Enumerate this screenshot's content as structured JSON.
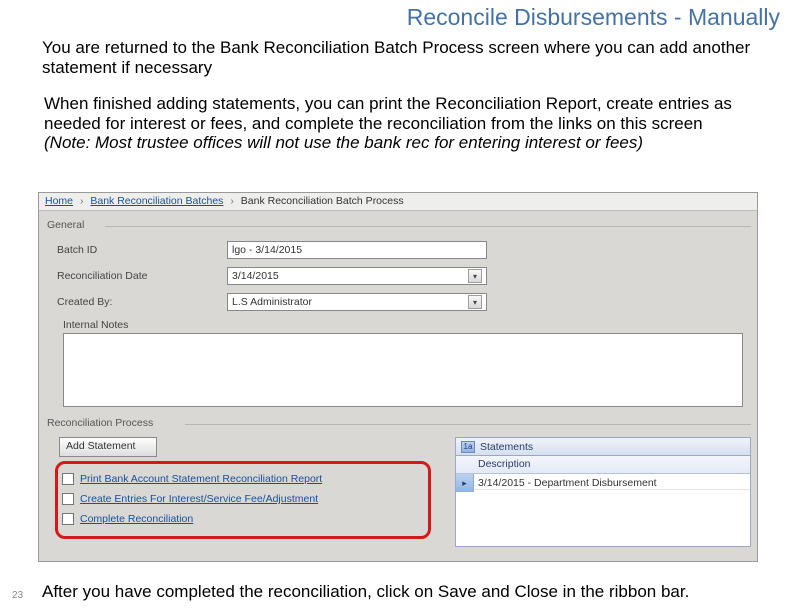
{
  "slide": {
    "title": "Reconcile Disbursements - Manually",
    "para1": "You are returned to the Bank Reconciliation Batch Process screen where you can add another statement if necessary",
    "para2_line1": "When finished adding statements, you can print the Reconciliation Report, create entries as needed for interest or fees, and complete the reconciliation from the links on this screen",
    "para2_note": "(Note:  Most trustee offices will not use the bank rec for entering interest or fees)",
    "footer": "After you have completed the reconciliation, click on Save and Close in the ribbon bar.",
    "page_number": "23"
  },
  "app": {
    "breadcrumb": {
      "home": "Home",
      "batches": "Bank Reconciliation Batches",
      "current": "Bank Reconciliation Batch Process"
    },
    "general": {
      "header": "General",
      "batch_id_label": "Batch ID",
      "batch_id_value": "lgo - 3/14/2015",
      "rec_date_label": "Reconciliation Date",
      "rec_date_value": "3/14/2015",
      "created_by_label": "Created By:",
      "created_by_value": "L.S Administrator",
      "notes_label": "Internal Notes"
    },
    "rec": {
      "header": "Reconciliation Process",
      "add_statement": "Add Statement",
      "links": {
        "print_report": "Print Bank Account Statement Reconciliation Report",
        "create_entries": "Create Entries For Interest/Service Fee/Adjustment",
        "complete": "Complete Reconciliation"
      },
      "statements": {
        "title": "Statements",
        "badge": "1a",
        "column_header": "Description",
        "row1": "3/14/2015 - Department Disbursement"
      }
    }
  }
}
